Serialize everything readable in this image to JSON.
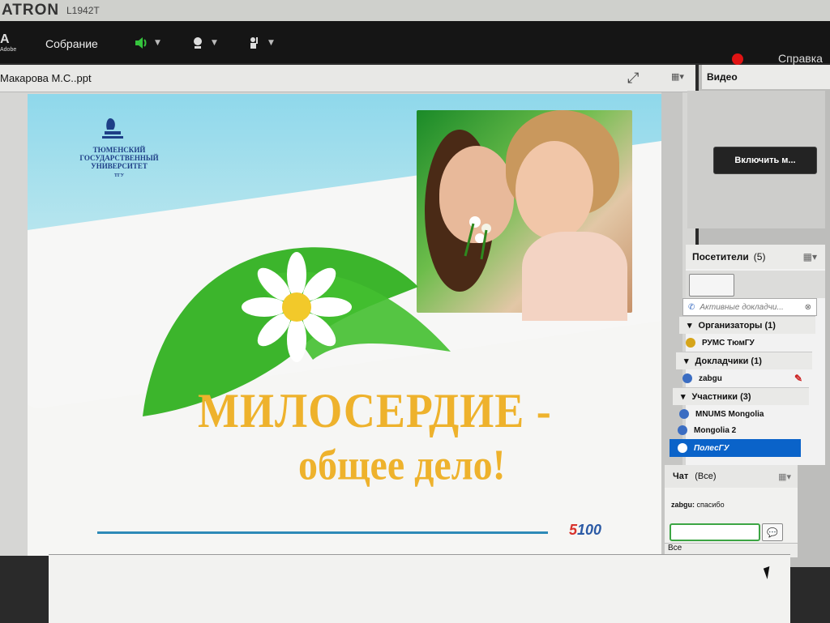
{
  "monitor": {
    "brand": "ATRON",
    "model": "L1942T"
  },
  "app": {
    "adobe_label": "Adobe",
    "meeting_menu": "Собрание",
    "help_menu": "Справка"
  },
  "share_pod": {
    "title": "Макарова М.С..ppt"
  },
  "slide": {
    "university": "ТЮМЕНСКИЙ ГОСУДАРСТВЕННЫЙ УНИВЕРСИТЕТ",
    "university_sub": "ТГУ",
    "headline1": "МИЛОСЕРДИЕ -",
    "headline2": "общее дело!",
    "brand_5": "5",
    "brand_100": "100"
  },
  "video_pod": {
    "title": "Видео",
    "enable_button": "Включить м..."
  },
  "attendees_pod": {
    "title": "Посетители",
    "count": "(5)",
    "active_speakers": "Активные докладчи...",
    "groups": [
      {
        "label": "Организаторы (1)"
      },
      {
        "label": "Докладчики (1)"
      },
      {
        "label": "Участники (3)"
      }
    ],
    "people": {
      "host": "РУМС ТюмГУ",
      "presenter": "zabgu",
      "participants": [
        "MNUMS Mongolia",
        "Mongolia 2",
        "ПолесГУ"
      ]
    }
  },
  "chat_pod": {
    "title": "Чат",
    "scope": "(Все)",
    "message_author": "zabgu:",
    "message_text": "спасибо",
    "footer_target": "Все"
  },
  "colors": {
    "accent_green": "#3ca544",
    "selection_blue": "#0a63c9",
    "headline_yellow": "#eeb22c",
    "record_red": "#e01313"
  }
}
